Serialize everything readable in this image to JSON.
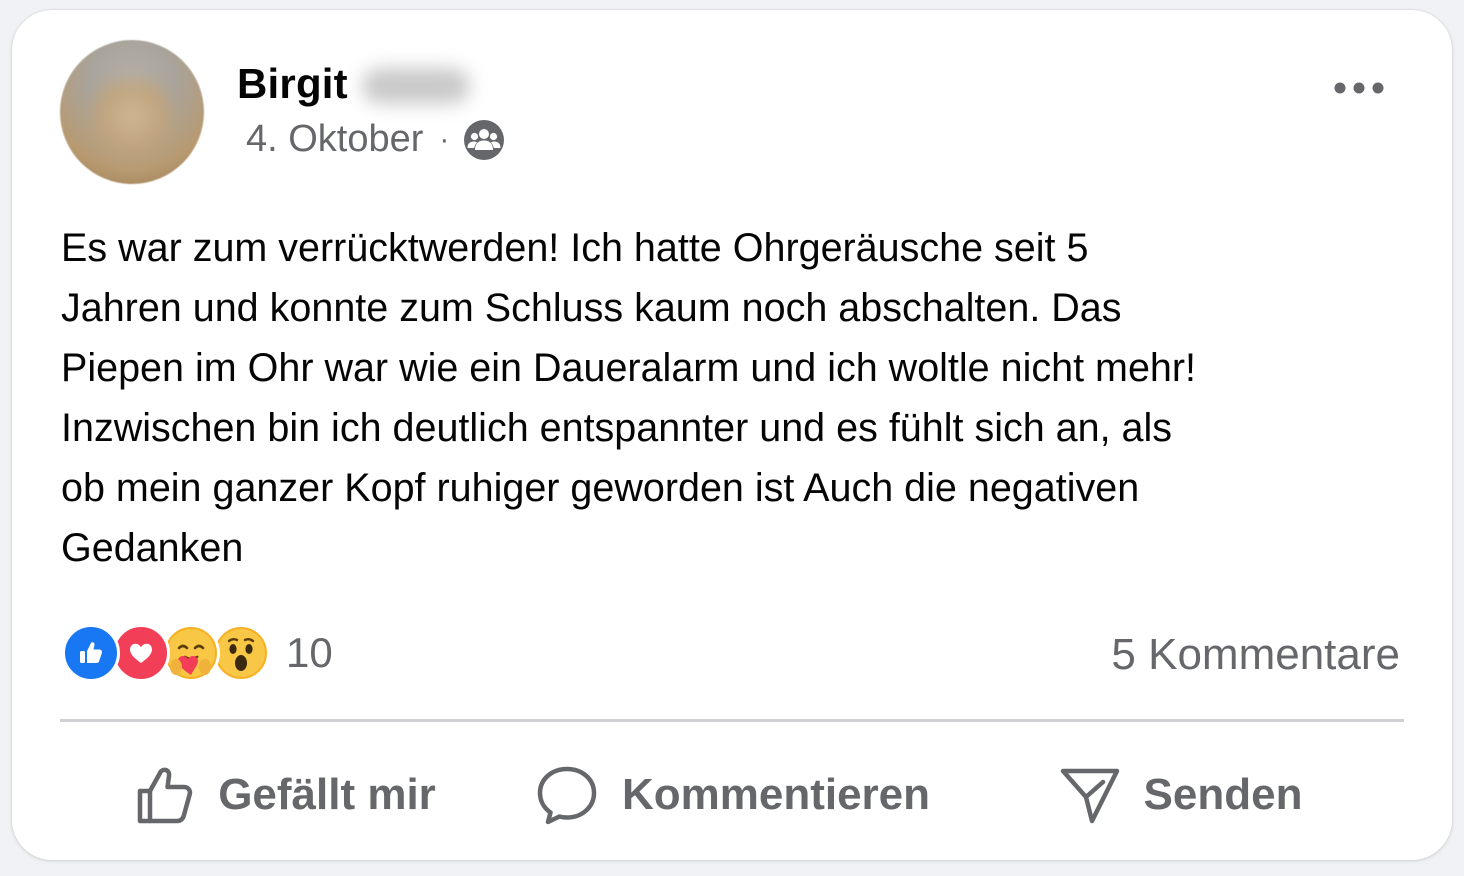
{
  "post": {
    "author_name": "Birgit",
    "date": "4. Oktober",
    "separator": "·",
    "audience_icon": "group-icon",
    "more_icon": "more-options-icon",
    "text": "Es war zum verrücktwerden! Ich hatte Ohrgeräusche seit 5\nJahren und konnte zum Schluss kaum noch abschalten. Das\nPiepen im Ohr war wie ein Daueralarm und ich woltle nicht mehr!\nInzwischen bin ich deutlich entspannter und es fühlt sich an, als\nob mein ganzer Kopf ruhiger geworden ist Auch die negativen\nGedanken"
  },
  "reactions": {
    "types": [
      "like",
      "love",
      "care",
      "wow"
    ],
    "count": "10",
    "comments_label": "5 Kommentare"
  },
  "actions": {
    "like_label": "Gefällt mir",
    "comment_label": "Kommentieren",
    "send_label": "Senden"
  },
  "colors": {
    "like_blue": "#1877f2",
    "love_red": "#f33e58",
    "emoji_yellow": "#f7b125",
    "secondary_text": "#65676b",
    "primary_text": "#050505"
  }
}
